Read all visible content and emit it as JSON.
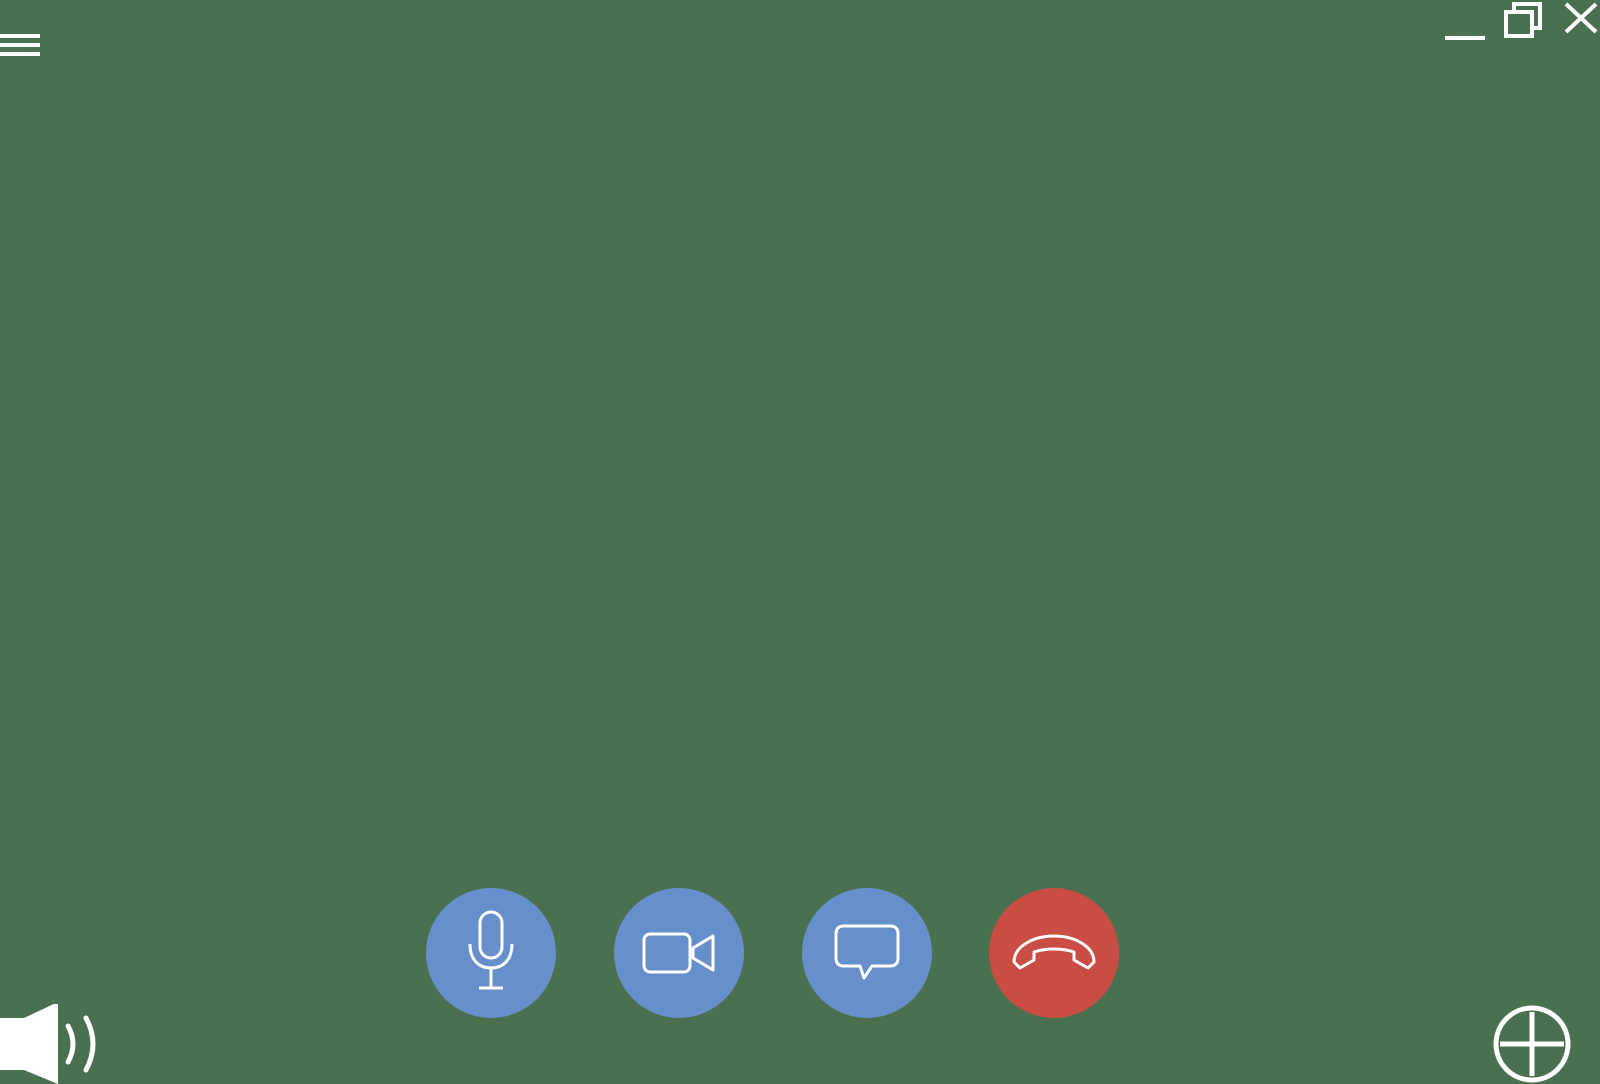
{
  "colors": {
    "background": "#4a714f",
    "control_button": "#678fcb",
    "hangup_button": "#c94d45",
    "icon_stroke": "#ffffff"
  },
  "window_controls": {
    "menu_icon": "hamburger-menu-icon",
    "minimize_icon": "minimize-icon",
    "restore_icon": "restore-window-icon",
    "close_icon": "close-icon"
  },
  "call_controls": [
    {
      "id": "mic",
      "icon": "microphone-icon",
      "color": "#678fcb"
    },
    {
      "id": "camera",
      "icon": "video-camera-icon",
      "color": "#678fcb"
    },
    {
      "id": "chat",
      "icon": "chat-bubble-icon",
      "color": "#678fcb"
    },
    {
      "id": "hangup",
      "icon": "hang-up-phone-icon",
      "color": "#c94d45"
    }
  ],
  "bottom_bar": {
    "speaker_icon": "speaker-volume-icon",
    "add_icon": "add-circle-icon"
  }
}
